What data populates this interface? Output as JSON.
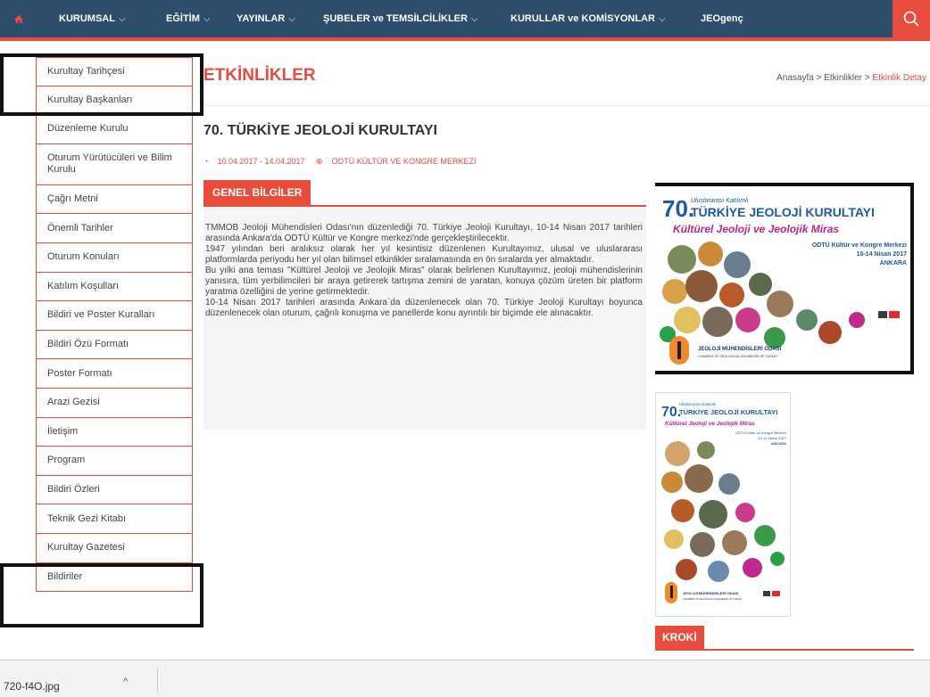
{
  "nav": {
    "items": [
      {
        "label": "KURUMSAL",
        "chevron": "⌵"
      },
      {
        "label": "EĞİTİM",
        "chevron": "⌵"
      },
      {
        "label": "YAYINLAR",
        "chevron": "⌵"
      },
      {
        "label": "ŞUBELER ve TEMSİLCİLİKLER",
        "chevron": "⌵"
      },
      {
        "label": "KURULLAR ve KOMİSYONLAR",
        "chevron": "⌵"
      },
      {
        "label": "JEOgenç",
        "chevron": ""
      }
    ]
  },
  "sidebar": {
    "items": [
      "Kurultay Tarihçesi",
      "Kurultay Başkanları",
      "Düzenleme Kurulu",
      "Oturum Yürütücüleri ve Bilim Kurulu",
      "Çağrı Metni",
      "Önemli Tarihler",
      "Oturum Konuları",
      "Katılım Koşulları",
      "Bildiri ve Poster Kuralları",
      "Bildiri Özü Formatı",
      "Poster Formatı",
      "Arazi Gezisi",
      "İletişim",
      "Program",
      "Bildiri Özleri",
      "Teknik Gezi Kitabı",
      "Kurultay Gazetesi",
      "Bildiriler"
    ]
  },
  "page": {
    "title": "ETKİNLİKLER",
    "breadcrumb": {
      "home": "Anasayfa",
      "sep1": " > ",
      "section": "Etkinlikler",
      "sep2": " > ",
      "current": "Etkinlik Detay"
    }
  },
  "event": {
    "title": "70. TÜRKİYE JEOLOJİ KURULTAYI",
    "dates": "10.04.2017 - 14.04.2017",
    "venue": "ODTÜ KÜLTÜR VE KONGRE MERKEZİ",
    "section_label": "GENEL BİLGİLER",
    "paragraphs": [
      "TMMOB Jeoloji Mühendisleri Odası'nın düzenlediği 70. Türkiye Jeoloji Kurultayı, 10-14 Nisan 2017 tarihleri arasında Ankara'da ODTÜ Kültür ve Kongre merkezi'nde gerçekleştirilecektir.",
      "1947 yılından beri aralıksız olarak her yıl kesintisiz düzenlenen Kurultayımız, ulusal ve uluslararası platformlarda periyodu her yıl olan bilimsel etkinlikler sıralamasında en ön sıralarda yer almaktadır.",
      "Bu yılki ana teması \"Kültürel Jeoloji ve Jeolojik Miras\" olarak belirlenen Kurultayımız, jeoloji mühendislerinin yanısıra, tüm yerbilimcileri bir araya getirerek tartışma zemini de yaratan, konuya çözüm üreten bir platform yaratma özelliğini de yerine getirmektedir.",
      "10-14 Nisan 2017 tarihleri arasında Ankara`da düzenlenecek olan 70. Türkiye Jeoloji Kurultayı boyunca düzenlenecek olan oturum, çağrılı konuşma ve panellerde konu ayrıntılı bir biçimde ele alınacaktır."
    ]
  },
  "poster": {
    "number": "70.",
    "subtitle": "Uluslararası Katılımlı",
    "title": "TÜRKİYE JEOLOJİ KURULTAYI",
    "theme": "Kültürel Jeoloji ve Jeolojik Miras",
    "venue": "ODTÜ Kültür ve Kongre Merkezi",
    "dates": "10-14 Nisan 2017",
    "city": "ANKARA",
    "org": "JEOLOJİ MÜHENDİSLERİ ODASI",
    "org_en": "CHAMBER OF GEOLOGICAL ENGINEERS OF TURKEY"
  },
  "kroki_label": "KROKİ",
  "download": {
    "filename": "720-f4O.jpg",
    "chevron": "^"
  },
  "colors": {
    "nav_bg": "#2c4d6b",
    "accent": "#e74c3c"
  }
}
